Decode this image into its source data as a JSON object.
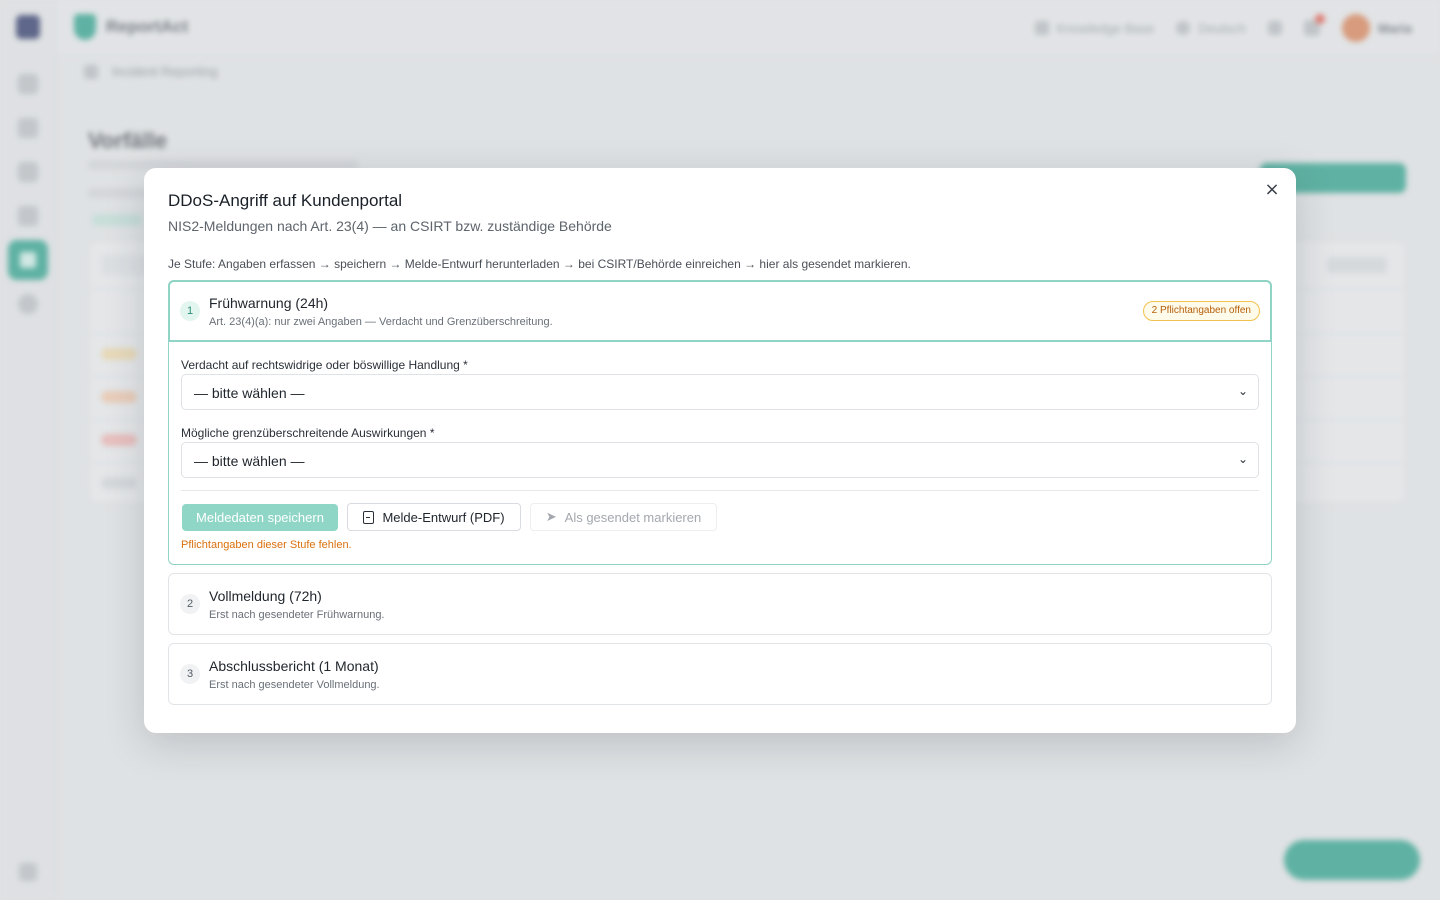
{
  "modal": {
    "title": "DDoS-Angriff auf Kundenportal",
    "subtitle": "NIS2-Meldungen nach Art. 23(4) — an CSIRT bzw. zuständige Behörde",
    "hint": "Je Stufe: Angaben erfassen → speichern → Melde-Entwurf herunterladen → bei CSIRT/Behörde einreichen → hier als gesendet markieren.",
    "close_icon": "×"
  },
  "stages": [
    {
      "number": "1",
      "title": "Frühwarnung (24h)",
      "description": "Art. 23(4)(a): nur zwei Angaben — Verdacht und Grenzüberschreitung.",
      "badge": "2 Pflichtangaben offen",
      "fields": [
        {
          "label": "Verdacht auf rechtswidrige oder böswillige Handlung *",
          "value": "— bitte wählen —"
        },
        {
          "label": "Mögliche grenzüberschreitende Auswirkungen *",
          "value": "— bitte wählen —"
        }
      ],
      "buttons": {
        "save": "Meldedaten speichern",
        "pdf": "Melde-Entwurf (PDF)",
        "sent": "Als gesendet markieren"
      },
      "warning": "Pflichtangaben dieser Stufe fehlen."
    },
    {
      "number": "2",
      "title": "Vollmeldung (72h)",
      "description": "Erst nach gesendeter Frühwarnung."
    },
    {
      "number": "3",
      "title": "Abschlussbericht (1 Monat)",
      "description": "Erst nach gesendeter Vollmeldung."
    }
  ],
  "background": {
    "brand": "ReportAct",
    "top_links": [
      "Knowledge Base",
      "Deutsch"
    ],
    "user": "Maria",
    "breadcrumb": "Incident Reporting",
    "page_title": "Vorfälle"
  },
  "colors": {
    "accent": "#1f9d85",
    "accent_light": "#8fd6c6",
    "warning": "#d9700d",
    "badge_border": "#f2c14e"
  }
}
